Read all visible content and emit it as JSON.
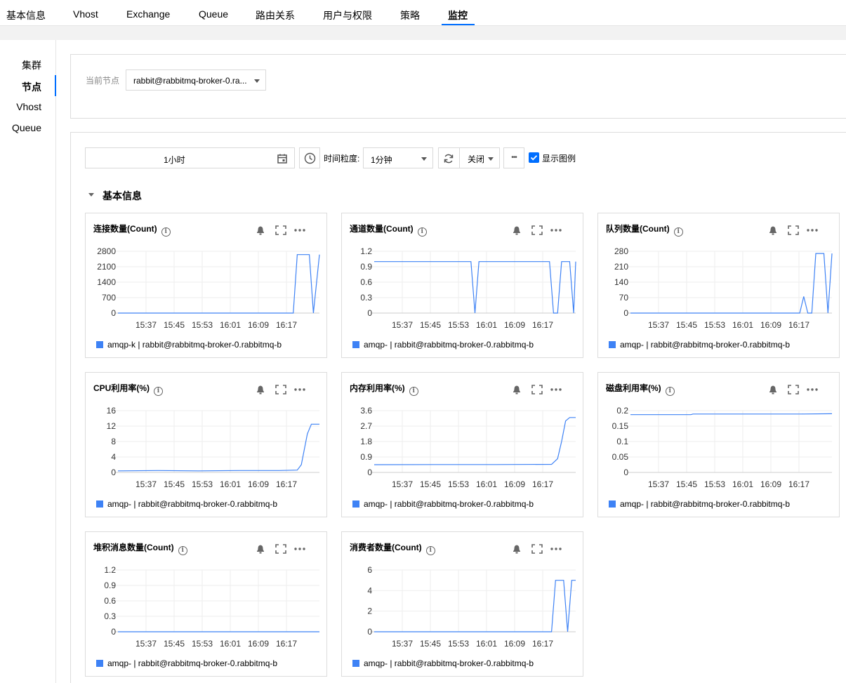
{
  "tabs": [
    "基本信息",
    "Vhost",
    "Exchange",
    "Queue",
    "路由关系",
    "用户与权限",
    "策略",
    "监控"
  ],
  "active_tab": "监控",
  "sidebar": {
    "items": [
      "集群",
      "节点",
      "Vhost",
      "Queue"
    ],
    "active": "节点"
  },
  "node_panel": {
    "label": "当前节点",
    "selected": "rabbit@rabbitmq-broker-0.ra..."
  },
  "toolbar": {
    "time_range": "1小时",
    "granularity_label": "时间粒度:",
    "granularity_value": "1分钟",
    "refresh_value": "关闭",
    "more": "•••",
    "show_legend_label": "显示图例",
    "show_legend_checked": true
  },
  "section": {
    "title": "基本信息"
  },
  "x_ticks": [
    "15:37",
    "15:45",
    "15:53",
    "16:01",
    "16:09",
    "16:17"
  ],
  "colors": {
    "accent": "#006eff",
    "series": "#3e82f5"
  },
  "charts": [
    {
      "title": "连接数量(Count)",
      "legend": "amqp-k  | rabbit@rabbitmq-broker-0.rabbitmq-b",
      "chart_data": {
        "type": "line",
        "ylim": [
          0,
          2800
        ],
        "y_ticks": [
          "2800",
          "2100",
          "1400",
          "700",
          "0"
        ],
        "x": [
          0,
          0.87,
          0.89,
          0.95,
          0.97,
          1.0
        ],
        "series": [
          {
            "values": [
              0,
              0,
              2650,
              2650,
              0,
              2650
            ]
          }
        ]
      }
    },
    {
      "title": "通道数量(Count)",
      "legend": "amqp-  | rabbit@rabbitmq-broker-0.rabbitmq-b",
      "chart_data": {
        "type": "line",
        "ylim": [
          0,
          1.2
        ],
        "y_ticks": [
          "1.2",
          "0.9",
          "0.6",
          "0.3",
          "0"
        ],
        "x": [
          0,
          0.48,
          0.5,
          0.52,
          0.87,
          0.89,
          0.91,
          0.93,
          0.97,
          0.99,
          1.0
        ],
        "series": [
          {
            "values": [
              1,
              1,
              0,
              1,
              1,
              0,
              0,
              1,
              1,
              0,
              1
            ]
          }
        ]
      }
    },
    {
      "title": "队列数量(Count)",
      "legend": "amqp-  | rabbit@rabbitmq-broker-0.rabbitmq-b",
      "chart_data": {
        "type": "line",
        "ylim": [
          0,
          280
        ],
        "y_ticks": [
          "280",
          "210",
          "140",
          "70",
          "0"
        ],
        "x": [
          0,
          0.84,
          0.86,
          0.88,
          0.9,
          0.92,
          0.96,
          0.98,
          1.0
        ],
        "series": [
          {
            "values": [
              0,
              0,
              75,
              0,
              0,
              270,
              270,
              0,
              270
            ]
          }
        ]
      }
    },
    {
      "title": "CPU利用率(%)",
      "legend": "amqp-  | rabbit@rabbitmq-broker-0.rabbitmq-b",
      "chart_data": {
        "type": "line",
        "ylim": [
          0,
          16
        ],
        "y_ticks": [
          "16",
          "12",
          "8",
          "4",
          "0"
        ],
        "x": [
          0,
          0.2,
          0.4,
          0.6,
          0.8,
          0.89,
          0.91,
          0.94,
          0.96,
          1.0
        ],
        "series": [
          {
            "values": [
              0.4,
              0.5,
              0.4,
              0.5,
              0.5,
              0.6,
              2,
              10,
              12.5,
              12.5
            ]
          }
        ]
      }
    },
    {
      "title": "内存利用率(%)",
      "legend": "amqp-  | rabbit@rabbitmq-broker-0.rabbitmq-b",
      "chart_data": {
        "type": "line",
        "ylim": [
          0,
          3.6
        ],
        "y_ticks": [
          "3.6",
          "2.7",
          "1.8",
          "0.9",
          "0"
        ],
        "x": [
          0,
          0.3,
          0.6,
          0.88,
          0.91,
          0.93,
          0.95,
          0.97,
          1.0
        ],
        "series": [
          {
            "values": [
              0.45,
              0.46,
              0.46,
              0.47,
              0.8,
              1.8,
              3.0,
              3.2,
              3.2
            ]
          }
        ]
      }
    },
    {
      "title": "磁盘利用率(%)",
      "legend": "amqp-  | rabbit@rabbitmq-broker-0.rabbitmq-b",
      "chart_data": {
        "type": "line",
        "ylim": [
          0,
          0.2
        ],
        "y_ticks": [
          "0.2",
          "0.15",
          "0.1",
          "0.05",
          "0"
        ],
        "x": [
          0,
          0.3,
          0.31,
          0.85,
          1.0
        ],
        "series": [
          {
            "values": [
              0.187,
              0.187,
              0.189,
              0.189,
              0.19
            ]
          }
        ]
      }
    },
    {
      "title": "堆积消息数量(Count)",
      "legend": "amqp-  | rabbit@rabbitmq-broker-0.rabbitmq-b",
      "chart_data": {
        "type": "line",
        "ylim": [
          0,
          1.2
        ],
        "y_ticks": [
          "1.2",
          "0.9",
          "0.6",
          "0.3",
          "0"
        ],
        "x": [
          0,
          1.0
        ],
        "series": [
          {
            "values": [
              0,
              0
            ]
          }
        ]
      }
    },
    {
      "title": "消费者数量(Count)",
      "legend": "amqp-  | rabbit@rabbitmq-broker-0.rabbitmq-b",
      "chart_data": {
        "type": "line",
        "ylim": [
          0,
          6
        ],
        "y_ticks": [
          "6",
          "4",
          "2",
          "0"
        ],
        "x": [
          0,
          0.88,
          0.9,
          0.94,
          0.96,
          0.98,
          1.0
        ],
        "series": [
          {
            "values": [
              0,
              0,
              5,
              5,
              0,
              5,
              5
            ]
          }
        ]
      }
    }
  ]
}
